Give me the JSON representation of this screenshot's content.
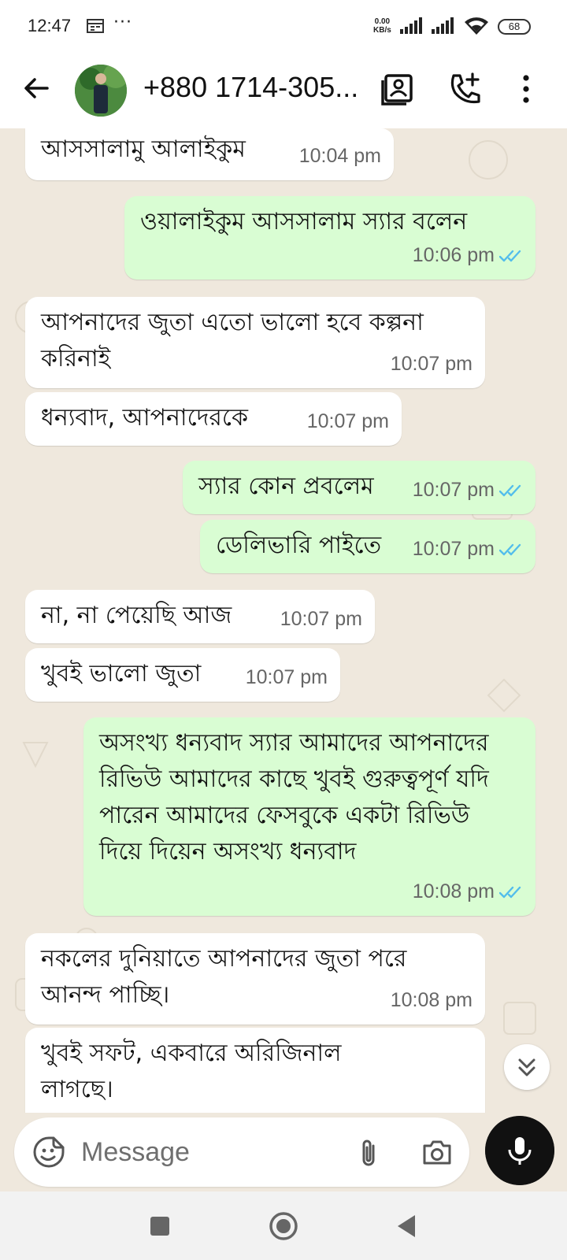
{
  "status_bar": {
    "time": "12:47",
    "dots": "···",
    "net_speed_value": "0.00",
    "net_speed_unit": "KB/s",
    "battery": "68",
    "icons": [
      "calendar-icon",
      "signal-icon",
      "signal-icon",
      "wifi-icon",
      "battery-icon"
    ]
  },
  "header": {
    "contact_name": "+880 1714-305...",
    "icons": [
      "back-arrow-icon",
      "avatar",
      "contact-card-icon",
      "add-call-icon",
      "more-vert-icon"
    ]
  },
  "messages": [
    {
      "direction": "in",
      "text": "আসসালামু আলাইকুম",
      "time": "10:04 pm"
    },
    {
      "direction": "out",
      "text": "ওয়ালাইকুম আসসালাম স্যার বলেন",
      "time": "10:06 pm",
      "status": "read"
    },
    {
      "direction": "in",
      "text": "আপনাদের জুতা এতো ভালো হবে কল্পনা করিনাই",
      "time": "10:07 pm"
    },
    {
      "direction": "in",
      "text": "ধন্যবাদ, আপনাদেরকে",
      "time": "10:07 pm"
    },
    {
      "direction": "out",
      "text": "স্যার কোন প্রবলেম",
      "time": "10:07 pm",
      "status": "read"
    },
    {
      "direction": "out",
      "text": "ডেলিভারি পাইতে",
      "time": "10:07 pm",
      "status": "read"
    },
    {
      "direction": "in",
      "text": "না, না পেয়েছি আজ",
      "time": "10:07 pm"
    },
    {
      "direction": "in",
      "text": "খুবই ভালো জুতা",
      "time": "10:07 pm"
    },
    {
      "direction": "out",
      "text": "অসংখ্য ধন্যবাদ স্যার আমাদের আপনাদের রিভিউ আমাদের কাছে খুবই গুরুত্বপূর্ণ যদি পারেন আমাদের ফেসবুকে একটা রিভিউ দিয়ে দিয়েন অসংখ্য ধন্যবাদ",
      "time": "10:08 pm",
      "status": "read"
    },
    {
      "direction": "in",
      "text": "নকলের দুনিয়াতে আপনাদের জুতা পরে আনন্দ পাচ্ছি।",
      "time": "10:08 pm"
    },
    {
      "direction": "in",
      "text": "খুবই সফট, একবারে অরিজিনাল লাগছে।",
      "time": ""
    }
  ],
  "input": {
    "placeholder": "Message"
  },
  "colors": {
    "chat_bg": "#efe8dd",
    "incoming_bubble": "#ffffff",
    "outgoing_bubble": "#d9fdd3",
    "read_tick": "#53bdeb",
    "mic_button": "#111111"
  }
}
